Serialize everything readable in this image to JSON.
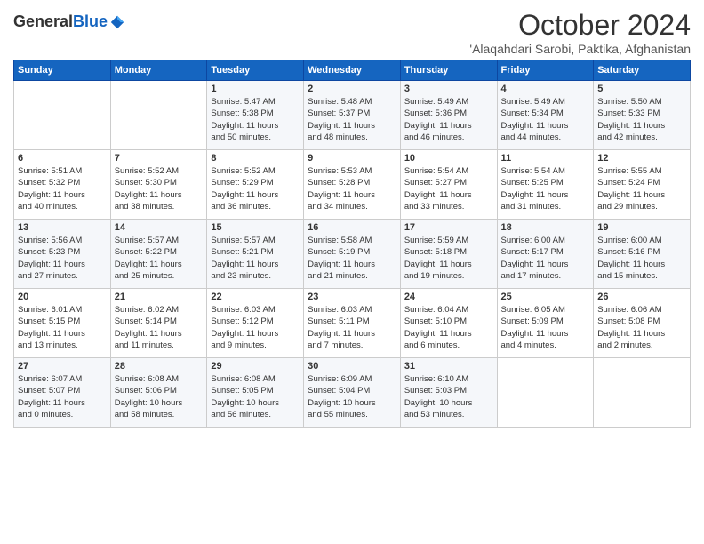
{
  "header": {
    "logo_general": "General",
    "logo_blue": "Blue",
    "title": "October 2024",
    "subtitle": "'Alaqahdari Sarobi, Paktika, Afghanistan"
  },
  "calendar": {
    "headers": [
      "Sunday",
      "Monday",
      "Tuesday",
      "Wednesday",
      "Thursday",
      "Friday",
      "Saturday"
    ],
    "weeks": [
      [
        {
          "day": "",
          "lines": []
        },
        {
          "day": "",
          "lines": []
        },
        {
          "day": "1",
          "lines": [
            "Sunrise: 5:47 AM",
            "Sunset: 5:38 PM",
            "Daylight: 11 hours",
            "and 50 minutes."
          ]
        },
        {
          "day": "2",
          "lines": [
            "Sunrise: 5:48 AM",
            "Sunset: 5:37 PM",
            "Daylight: 11 hours",
            "and 48 minutes."
          ]
        },
        {
          "day": "3",
          "lines": [
            "Sunrise: 5:49 AM",
            "Sunset: 5:36 PM",
            "Daylight: 11 hours",
            "and 46 minutes."
          ]
        },
        {
          "day": "4",
          "lines": [
            "Sunrise: 5:49 AM",
            "Sunset: 5:34 PM",
            "Daylight: 11 hours",
            "and 44 minutes."
          ]
        },
        {
          "day": "5",
          "lines": [
            "Sunrise: 5:50 AM",
            "Sunset: 5:33 PM",
            "Daylight: 11 hours",
            "and 42 minutes."
          ]
        }
      ],
      [
        {
          "day": "6",
          "lines": [
            "Sunrise: 5:51 AM",
            "Sunset: 5:32 PM",
            "Daylight: 11 hours",
            "and 40 minutes."
          ]
        },
        {
          "day": "7",
          "lines": [
            "Sunrise: 5:52 AM",
            "Sunset: 5:30 PM",
            "Daylight: 11 hours",
            "and 38 minutes."
          ]
        },
        {
          "day": "8",
          "lines": [
            "Sunrise: 5:52 AM",
            "Sunset: 5:29 PM",
            "Daylight: 11 hours",
            "and 36 minutes."
          ]
        },
        {
          "day": "9",
          "lines": [
            "Sunrise: 5:53 AM",
            "Sunset: 5:28 PM",
            "Daylight: 11 hours",
            "and 34 minutes."
          ]
        },
        {
          "day": "10",
          "lines": [
            "Sunrise: 5:54 AM",
            "Sunset: 5:27 PM",
            "Daylight: 11 hours",
            "and 33 minutes."
          ]
        },
        {
          "day": "11",
          "lines": [
            "Sunrise: 5:54 AM",
            "Sunset: 5:25 PM",
            "Daylight: 11 hours",
            "and 31 minutes."
          ]
        },
        {
          "day": "12",
          "lines": [
            "Sunrise: 5:55 AM",
            "Sunset: 5:24 PM",
            "Daylight: 11 hours",
            "and 29 minutes."
          ]
        }
      ],
      [
        {
          "day": "13",
          "lines": [
            "Sunrise: 5:56 AM",
            "Sunset: 5:23 PM",
            "Daylight: 11 hours",
            "and 27 minutes."
          ]
        },
        {
          "day": "14",
          "lines": [
            "Sunrise: 5:57 AM",
            "Sunset: 5:22 PM",
            "Daylight: 11 hours",
            "and 25 minutes."
          ]
        },
        {
          "day": "15",
          "lines": [
            "Sunrise: 5:57 AM",
            "Sunset: 5:21 PM",
            "Daylight: 11 hours",
            "and 23 minutes."
          ]
        },
        {
          "day": "16",
          "lines": [
            "Sunrise: 5:58 AM",
            "Sunset: 5:19 PM",
            "Daylight: 11 hours",
            "and 21 minutes."
          ]
        },
        {
          "day": "17",
          "lines": [
            "Sunrise: 5:59 AM",
            "Sunset: 5:18 PM",
            "Daylight: 11 hours",
            "and 19 minutes."
          ]
        },
        {
          "day": "18",
          "lines": [
            "Sunrise: 6:00 AM",
            "Sunset: 5:17 PM",
            "Daylight: 11 hours",
            "and 17 minutes."
          ]
        },
        {
          "day": "19",
          "lines": [
            "Sunrise: 6:00 AM",
            "Sunset: 5:16 PM",
            "Daylight: 11 hours",
            "and 15 minutes."
          ]
        }
      ],
      [
        {
          "day": "20",
          "lines": [
            "Sunrise: 6:01 AM",
            "Sunset: 5:15 PM",
            "Daylight: 11 hours",
            "and 13 minutes."
          ]
        },
        {
          "day": "21",
          "lines": [
            "Sunrise: 6:02 AM",
            "Sunset: 5:14 PM",
            "Daylight: 11 hours",
            "and 11 minutes."
          ]
        },
        {
          "day": "22",
          "lines": [
            "Sunrise: 6:03 AM",
            "Sunset: 5:12 PM",
            "Daylight: 11 hours",
            "and 9 minutes."
          ]
        },
        {
          "day": "23",
          "lines": [
            "Sunrise: 6:03 AM",
            "Sunset: 5:11 PM",
            "Daylight: 11 hours",
            "and 7 minutes."
          ]
        },
        {
          "day": "24",
          "lines": [
            "Sunrise: 6:04 AM",
            "Sunset: 5:10 PM",
            "Daylight: 11 hours",
            "and 6 minutes."
          ]
        },
        {
          "day": "25",
          "lines": [
            "Sunrise: 6:05 AM",
            "Sunset: 5:09 PM",
            "Daylight: 11 hours",
            "and 4 minutes."
          ]
        },
        {
          "day": "26",
          "lines": [
            "Sunrise: 6:06 AM",
            "Sunset: 5:08 PM",
            "Daylight: 11 hours",
            "and 2 minutes."
          ]
        }
      ],
      [
        {
          "day": "27",
          "lines": [
            "Sunrise: 6:07 AM",
            "Sunset: 5:07 PM",
            "Daylight: 11 hours",
            "and 0 minutes."
          ]
        },
        {
          "day": "28",
          "lines": [
            "Sunrise: 6:08 AM",
            "Sunset: 5:06 PM",
            "Daylight: 10 hours",
            "and 58 minutes."
          ]
        },
        {
          "day": "29",
          "lines": [
            "Sunrise: 6:08 AM",
            "Sunset: 5:05 PM",
            "Daylight: 10 hours",
            "and 56 minutes."
          ]
        },
        {
          "day": "30",
          "lines": [
            "Sunrise: 6:09 AM",
            "Sunset: 5:04 PM",
            "Daylight: 10 hours",
            "and 55 minutes."
          ]
        },
        {
          "day": "31",
          "lines": [
            "Sunrise: 6:10 AM",
            "Sunset: 5:03 PM",
            "Daylight: 10 hours",
            "and 53 minutes."
          ]
        },
        {
          "day": "",
          "lines": []
        },
        {
          "day": "",
          "lines": []
        }
      ]
    ]
  }
}
